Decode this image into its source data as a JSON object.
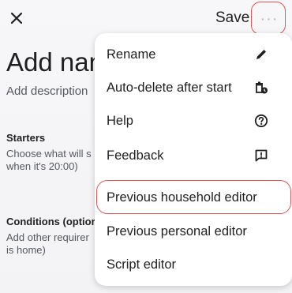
{
  "header": {
    "close_icon": "close-icon",
    "save_label": "Save",
    "more_label": "···",
    "more_icon": "more-horizontal-icon"
  },
  "content": {
    "title": "Add nam",
    "description": "Add description",
    "starters": {
      "heading": "Starters",
      "line1": "Choose what will s",
      "line2": "when it's 20:00)"
    },
    "conditions": {
      "heading": "Conditions (optior",
      "line1": "Add other requirer",
      "line2": "is home)"
    }
  },
  "menu": {
    "items": [
      {
        "label": "Rename",
        "icon": "pencil-icon"
      },
      {
        "label": "Auto-delete after start",
        "icon": "auto-delete-icon"
      },
      {
        "label": "Help",
        "icon": "help-circle-icon"
      },
      {
        "label": "Feedback",
        "icon": "feedback-icon"
      },
      {
        "label": "Previous household editor",
        "icon": ""
      },
      {
        "label": "Previous personal editor",
        "icon": ""
      },
      {
        "label": "Script editor",
        "icon": ""
      }
    ]
  },
  "colors": {
    "highlight": "#e05555",
    "background": "#f6f6f8",
    "menu_background": "#ffffff",
    "text": "#1f1f1f"
  }
}
